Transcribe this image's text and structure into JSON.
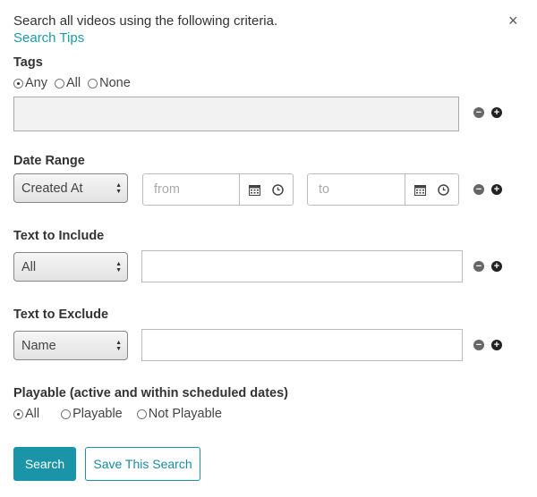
{
  "header": {
    "intro": "Search all videos using the following criteria.",
    "tips_link": "Search Tips",
    "close_glyph": "×"
  },
  "tags": {
    "label": "Tags",
    "options": [
      "Any",
      "All",
      "None"
    ],
    "selected": "Any"
  },
  "date_range": {
    "label": "Date Range",
    "select_value": "Created At",
    "from_placeholder": "from",
    "to_placeholder": "to"
  },
  "text_include": {
    "label": "Text to Include",
    "select_value": "All",
    "value": ""
  },
  "text_exclude": {
    "label": "Text to Exclude",
    "select_value": "Name",
    "value": ""
  },
  "playable": {
    "label": "Playable (active and within scheduled dates)",
    "options": [
      "All",
      "Playable",
      "Not Playable"
    ],
    "selected": "All"
  },
  "actions": {
    "search": "Search",
    "save": "Save This Search"
  },
  "colors": {
    "accent": "#1a94a9",
    "link": "#1a9bb0"
  }
}
